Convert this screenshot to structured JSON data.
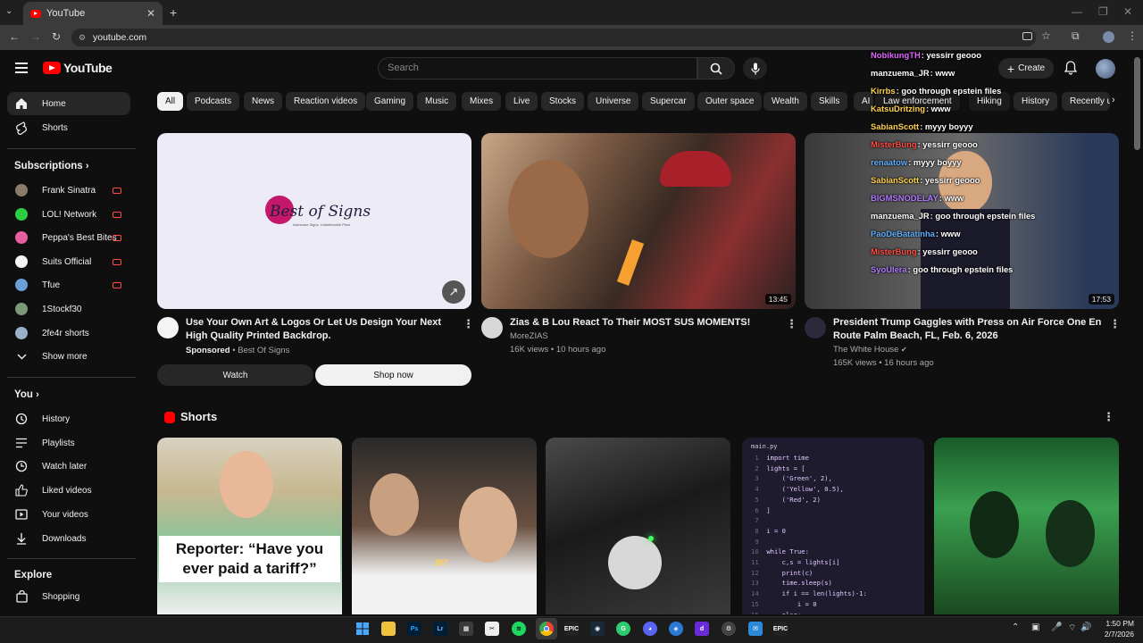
{
  "browser": {
    "tab_title": "YouTube",
    "url": "youtube.com"
  },
  "header": {
    "search_placeholder": "Search",
    "create_label": "Create",
    "logo_text": "YouTube"
  },
  "sidebar": {
    "main": [
      {
        "label": "Home",
        "icon": "home-icon"
      },
      {
        "label": "Shorts",
        "icon": "shorts-icon"
      }
    ],
    "subs_heading": "Subscriptions",
    "subs": [
      {
        "label": "Frank Sinatra",
        "color": "#8a7a6a",
        "live": true
      },
      {
        "label": "LOL! Network",
        "color": "#2ecc40",
        "live": true
      },
      {
        "label": "Peppa's Best Bites",
        "color": "#e85fa0",
        "live": true
      },
      {
        "label": "Suits Official",
        "color": "#f5f5f5",
        "live": true
      },
      {
        "label": "Tfue",
        "color": "#6aa0d8",
        "live": true
      },
      {
        "label": "1Stockf30",
        "color": "#7a9a7a",
        "live": false
      },
      {
        "label": "2fe4r shorts",
        "color": "#9ab0c8",
        "live": false
      }
    ],
    "show_more": "Show more",
    "you_heading": "You",
    "you": [
      {
        "label": "History",
        "icon": "history-icon"
      },
      {
        "label": "Playlists",
        "icon": "playlists-icon"
      },
      {
        "label": "Watch later",
        "icon": "watch-later-icon"
      },
      {
        "label": "Liked videos",
        "icon": "like-icon"
      },
      {
        "label": "Your videos",
        "icon": "your-videos-icon"
      },
      {
        "label": "Downloads",
        "icon": "download-icon"
      }
    ],
    "explore_heading": "Explore",
    "explore": [
      {
        "label": "Shopping",
        "icon": "shopping-icon"
      }
    ]
  },
  "chips": [
    "All",
    "Podcasts",
    "News",
    "Reaction videos",
    "Gaming",
    "Music",
    "Mixes",
    "Live",
    "Stocks",
    "Universe",
    "Supercar",
    "Outer space",
    "Wealth",
    "Skills",
    "AI",
    "Law enforcement",
    "Hiking",
    "History",
    "Recently u"
  ],
  "videos": [
    {
      "title": "Use Your Own Art & Logos Or Let Us Design Your Next High Quality Printed Backdrop.",
      "sponsored": "Sponsored",
      "channel": "Best Of Signs",
      "brand": "Best of Signs",
      "tagline": "Awesome Signs. Unbelievable Price.",
      "watch": "Watch",
      "shop": "Shop now"
    },
    {
      "title": "Zias & B Lou React To Their MOST SUS MOMENTS!",
      "channel": "MoreZIAS",
      "meta": "16K views • 10 hours ago",
      "duration": "13:45"
    },
    {
      "title": "President Trump Gaggles with Press on Air Force One En Route Palm Beach, FL, Feb. 6, 2026",
      "channel": "The White House",
      "meta": "165K views • 16 hours ago",
      "duration": "17:53"
    }
  ],
  "shorts_heading": "Shorts",
  "shorts": [
    {
      "caption": "Reporter: “Have you ever paid a tariff?”"
    },
    {
      "caption": "BIT"
    },
    {
      "caption": ""
    },
    {
      "file": "main.py",
      "code": [
        "import time",
        "lights = [",
        "    ('Green', 2),",
        "    ('Yellow', 0.5),",
        "    ('Red', 2)",
        "]",
        "",
        "i = 0",
        "",
        "while True:",
        "    c,s = lights[i]",
        "    print(c)",
        "    time.sleep(s)",
        "    if i == len(lights)-1:",
        "        i = 0",
        "    else:",
        "        i += 1"
      ]
    },
    {
      "caption": ""
    }
  ],
  "chat": [
    {
      "user": "NobikungTH",
      "msg": "yessirr geooo",
      "color": "#e066ff"
    },
    {
      "user": "manzuema_JR",
      "msg": "www",
      "color": "#ffffff"
    },
    {
      "user": "Kirrbs",
      "msg": "goo through epstein files",
      "color": "#ffd24d"
    },
    {
      "user": "KatsuDritzing",
      "msg": "www",
      "color": "#ffd24d"
    },
    {
      "user": "SabianScott",
      "msg": "myyy boyyy",
      "color": "#ffd24d"
    },
    {
      "user": "MisterBung",
      "msg": "yessirr geooo",
      "color": "#ff4e45"
    },
    {
      "user": "renaatow",
      "msg": "myyy boyyy",
      "color": "#5fb0ff"
    },
    {
      "user": "SabianScott",
      "msg": "yessirr geooo",
      "color": "#ffd24d"
    },
    {
      "user": "BIGMSNODELAY",
      "msg": "www",
      "color": "#b07cff"
    },
    {
      "user": "manzuema_JR",
      "msg": "goo through epstein files",
      "color": "#ffffff"
    },
    {
      "user": "PaoDeBatatinha",
      "msg": "www",
      "color": "#5fb0ff"
    },
    {
      "user": "MisterBung",
      "msg": "yessirr geooo",
      "color": "#ff4e45"
    },
    {
      "user": "SyoUlera",
      "msg": "goo through epstein files",
      "color": "#b07cff"
    }
  ],
  "clock": {
    "time": "1:50 PM",
    "date": "2/7/2026"
  }
}
